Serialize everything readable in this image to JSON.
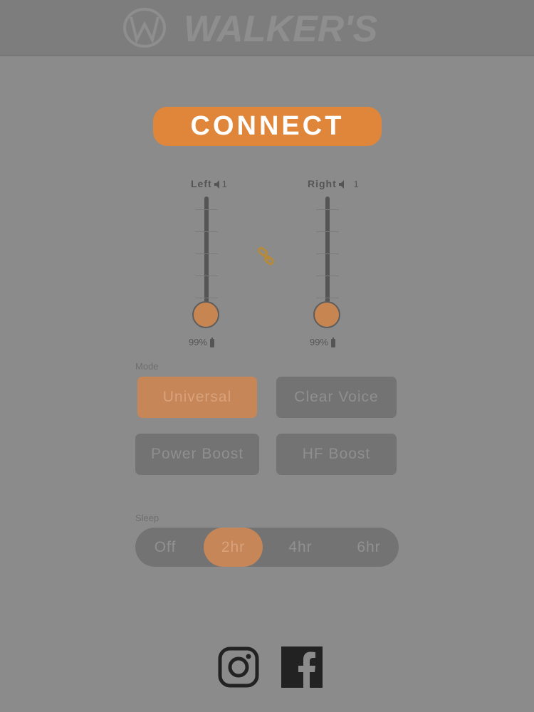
{
  "header": {
    "brand": "WALKER'S",
    "logo_icon": "walkers-logo"
  },
  "connect": {
    "label": "CONNECT"
  },
  "channels": {
    "left": {
      "label": "Left",
      "number": "1",
      "battery": "99%",
      "level": 0.0
    },
    "right": {
      "label": "Right",
      "number": "1",
      "battery": "99%",
      "level": 0.0
    },
    "link_icon": "link-chain-icon"
  },
  "mode": {
    "label": "Mode",
    "options": [
      "Universal",
      "Clear Voice",
      "Power Boost",
      "HF Boost"
    ],
    "selected": "Universal"
  },
  "sleep": {
    "label": "Sleep",
    "options": [
      "Off",
      "2hr",
      "4hr",
      "6hr"
    ],
    "selected": "2hr"
  },
  "social": {
    "icons": [
      "instagram-icon",
      "facebook-icon"
    ]
  },
  "colors": {
    "accent": "#e0863b",
    "background": "#8b8b8b",
    "active_muted": "#c68658"
  }
}
